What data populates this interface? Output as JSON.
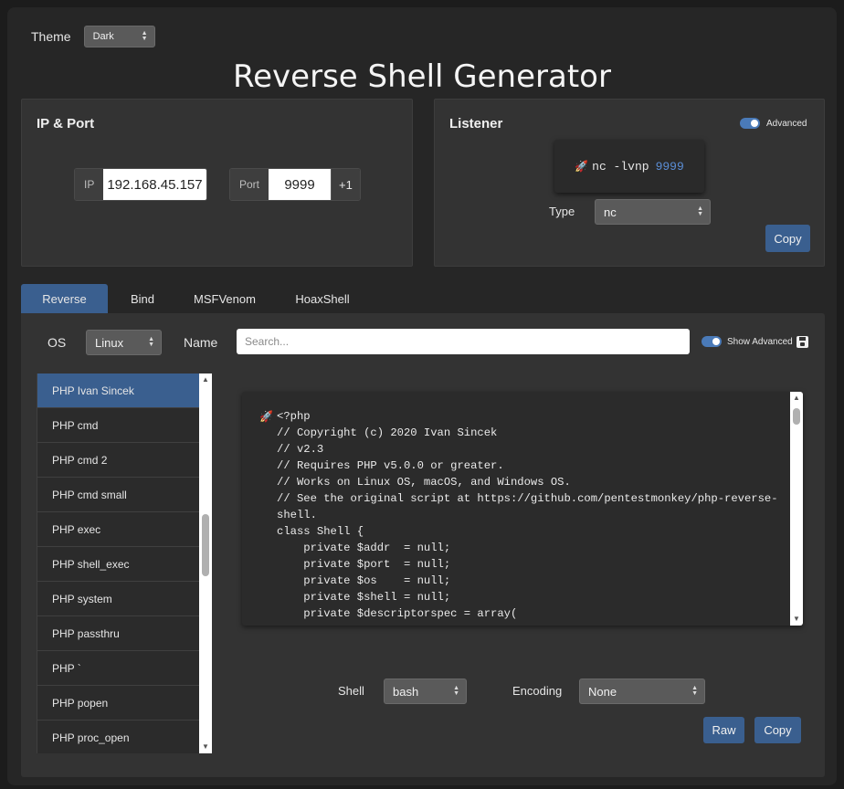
{
  "theme": {
    "label": "Theme",
    "value": "Dark"
  },
  "title": "Reverse Shell Generator",
  "ip_port": {
    "title": "IP & Port",
    "ip_label": "IP",
    "ip_value": "192.168.45.157",
    "port_label": "Port",
    "port_value": "9999",
    "increment_label": "+1"
  },
  "listener": {
    "title": "Listener",
    "advanced_label": "Advanced",
    "command_prefix": "nc -lvnp",
    "command_port": "9999",
    "type_label": "Type",
    "type_value": "nc",
    "copy_label": "Copy"
  },
  "tabs": [
    "Reverse",
    "Bind",
    "MSFVenom",
    "HoaxShell"
  ],
  "filters": {
    "os_label": "OS",
    "os_value": "Linux",
    "name_label": "Name",
    "search_placeholder": "Search...",
    "show_advanced_label": "Show Advanced"
  },
  "shells": [
    "PHP Ivan Sincek",
    "PHP cmd",
    "PHP cmd 2",
    "PHP cmd small",
    "PHP exec",
    "PHP shell_exec",
    "PHP system",
    "PHP passthru",
    "PHP `",
    "PHP popen",
    "PHP proc_open"
  ],
  "code": "<?php\n// Copyright (c) 2020 Ivan Sincek\n// v2.3\n// Requires PHP v5.0.0 or greater.\n// Works on Linux OS, macOS, and Windows OS.\n// See the original script at https://github.com/pentestmonkey/php-reverse-\nshell.\nclass Shell {\n    private $addr  = null;\n    private $port  = null;\n    private $os    = null;\n    private $shell = null;\n    private $descriptorspec = array(",
  "bottom": {
    "shell_label": "Shell",
    "shell_value": "bash",
    "encoding_label": "Encoding",
    "encoding_value": "None",
    "raw_label": "Raw",
    "copy_label": "Copy"
  },
  "colors": {
    "accent": "#3a5f8f",
    "port_highlight": "#5b8ed6"
  }
}
